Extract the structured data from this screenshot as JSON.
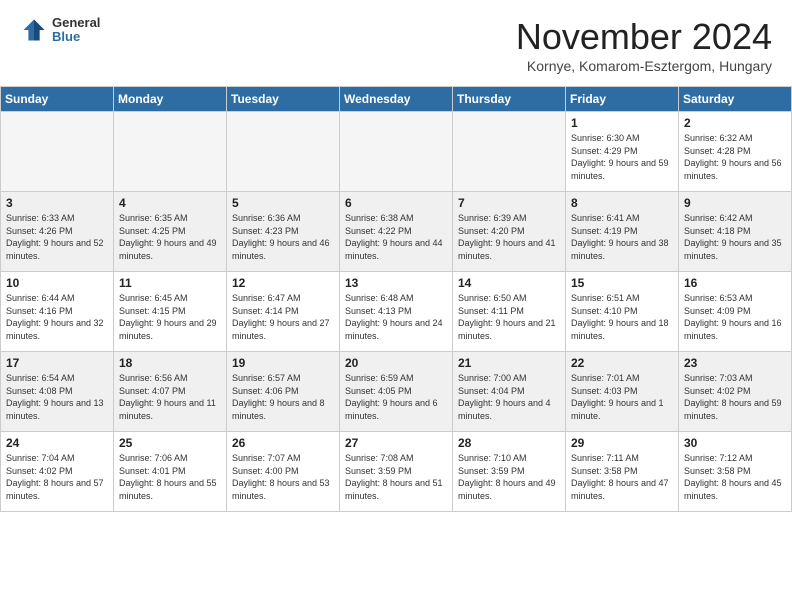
{
  "logo": {
    "general": "General",
    "blue": "Blue"
  },
  "title": "November 2024",
  "location": "Kornye, Komarom-Esztergom, Hungary",
  "weekdays": [
    "Sunday",
    "Monday",
    "Tuesday",
    "Wednesday",
    "Thursday",
    "Friday",
    "Saturday"
  ],
  "weeks": [
    [
      {
        "day": "",
        "info": ""
      },
      {
        "day": "",
        "info": ""
      },
      {
        "day": "",
        "info": ""
      },
      {
        "day": "",
        "info": ""
      },
      {
        "day": "",
        "info": ""
      },
      {
        "day": "1",
        "info": "Sunrise: 6:30 AM\nSunset: 4:29 PM\nDaylight: 9 hours and 59 minutes."
      },
      {
        "day": "2",
        "info": "Sunrise: 6:32 AM\nSunset: 4:28 PM\nDaylight: 9 hours and 56 minutes."
      }
    ],
    [
      {
        "day": "3",
        "info": "Sunrise: 6:33 AM\nSunset: 4:26 PM\nDaylight: 9 hours and 52 minutes."
      },
      {
        "day": "4",
        "info": "Sunrise: 6:35 AM\nSunset: 4:25 PM\nDaylight: 9 hours and 49 minutes."
      },
      {
        "day": "5",
        "info": "Sunrise: 6:36 AM\nSunset: 4:23 PM\nDaylight: 9 hours and 46 minutes."
      },
      {
        "day": "6",
        "info": "Sunrise: 6:38 AM\nSunset: 4:22 PM\nDaylight: 9 hours and 44 minutes."
      },
      {
        "day": "7",
        "info": "Sunrise: 6:39 AM\nSunset: 4:20 PM\nDaylight: 9 hours and 41 minutes."
      },
      {
        "day": "8",
        "info": "Sunrise: 6:41 AM\nSunset: 4:19 PM\nDaylight: 9 hours and 38 minutes."
      },
      {
        "day": "9",
        "info": "Sunrise: 6:42 AM\nSunset: 4:18 PM\nDaylight: 9 hours and 35 minutes."
      }
    ],
    [
      {
        "day": "10",
        "info": "Sunrise: 6:44 AM\nSunset: 4:16 PM\nDaylight: 9 hours and 32 minutes."
      },
      {
        "day": "11",
        "info": "Sunrise: 6:45 AM\nSunset: 4:15 PM\nDaylight: 9 hours and 29 minutes."
      },
      {
        "day": "12",
        "info": "Sunrise: 6:47 AM\nSunset: 4:14 PM\nDaylight: 9 hours and 27 minutes."
      },
      {
        "day": "13",
        "info": "Sunrise: 6:48 AM\nSunset: 4:13 PM\nDaylight: 9 hours and 24 minutes."
      },
      {
        "day": "14",
        "info": "Sunrise: 6:50 AM\nSunset: 4:11 PM\nDaylight: 9 hours and 21 minutes."
      },
      {
        "day": "15",
        "info": "Sunrise: 6:51 AM\nSunset: 4:10 PM\nDaylight: 9 hours and 18 minutes."
      },
      {
        "day": "16",
        "info": "Sunrise: 6:53 AM\nSunset: 4:09 PM\nDaylight: 9 hours and 16 minutes."
      }
    ],
    [
      {
        "day": "17",
        "info": "Sunrise: 6:54 AM\nSunset: 4:08 PM\nDaylight: 9 hours and 13 minutes."
      },
      {
        "day": "18",
        "info": "Sunrise: 6:56 AM\nSunset: 4:07 PM\nDaylight: 9 hours and 11 minutes."
      },
      {
        "day": "19",
        "info": "Sunrise: 6:57 AM\nSunset: 4:06 PM\nDaylight: 9 hours and 8 minutes."
      },
      {
        "day": "20",
        "info": "Sunrise: 6:59 AM\nSunset: 4:05 PM\nDaylight: 9 hours and 6 minutes."
      },
      {
        "day": "21",
        "info": "Sunrise: 7:00 AM\nSunset: 4:04 PM\nDaylight: 9 hours and 4 minutes."
      },
      {
        "day": "22",
        "info": "Sunrise: 7:01 AM\nSunset: 4:03 PM\nDaylight: 9 hours and 1 minute."
      },
      {
        "day": "23",
        "info": "Sunrise: 7:03 AM\nSunset: 4:02 PM\nDaylight: 8 hours and 59 minutes."
      }
    ],
    [
      {
        "day": "24",
        "info": "Sunrise: 7:04 AM\nSunset: 4:02 PM\nDaylight: 8 hours and 57 minutes."
      },
      {
        "day": "25",
        "info": "Sunrise: 7:06 AM\nSunset: 4:01 PM\nDaylight: 8 hours and 55 minutes."
      },
      {
        "day": "26",
        "info": "Sunrise: 7:07 AM\nSunset: 4:00 PM\nDaylight: 8 hours and 53 minutes."
      },
      {
        "day": "27",
        "info": "Sunrise: 7:08 AM\nSunset: 3:59 PM\nDaylight: 8 hours and 51 minutes."
      },
      {
        "day": "28",
        "info": "Sunrise: 7:10 AM\nSunset: 3:59 PM\nDaylight: 8 hours and 49 minutes."
      },
      {
        "day": "29",
        "info": "Sunrise: 7:11 AM\nSunset: 3:58 PM\nDaylight: 8 hours and 47 minutes."
      },
      {
        "day": "30",
        "info": "Sunrise: 7:12 AM\nSunset: 3:58 PM\nDaylight: 8 hours and 45 minutes."
      }
    ]
  ]
}
